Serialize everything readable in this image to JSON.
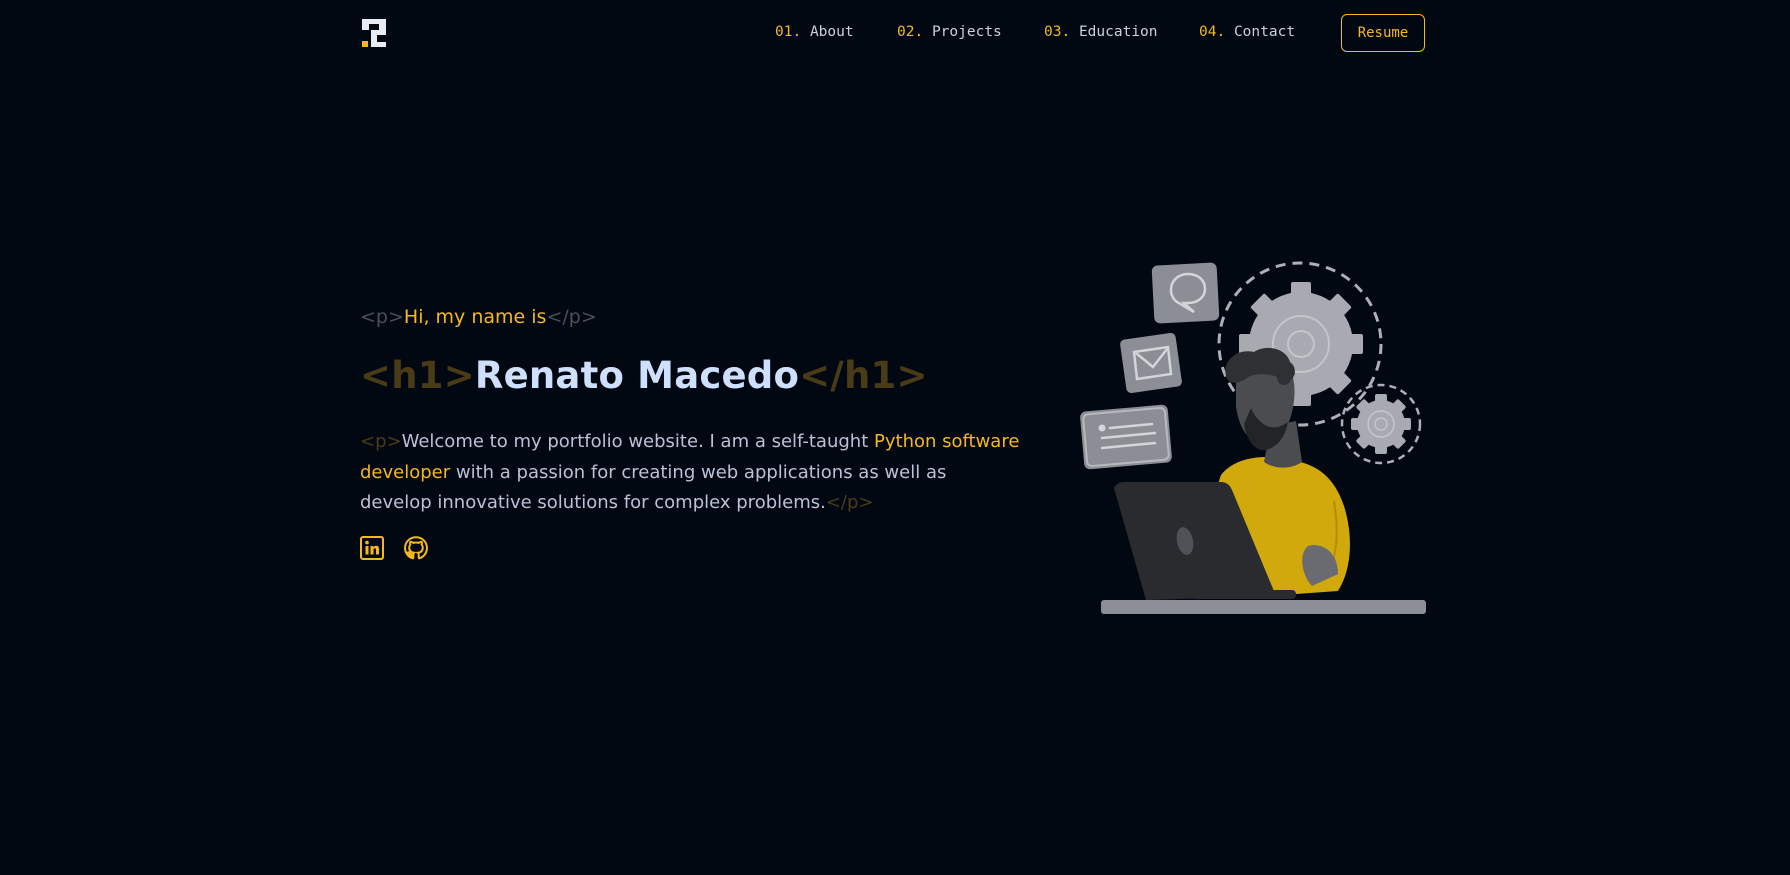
{
  "header": {
    "logo_icon": "monogram-logo-icon",
    "nav": [
      {
        "num": "01.",
        "label": "About"
      },
      {
        "num": "02.",
        "label": "Projects"
      },
      {
        "num": "03.",
        "label": "Education"
      },
      {
        "num": "04.",
        "label": "Contact"
      }
    ],
    "resume_label": "Resume"
  },
  "hero": {
    "intro_open_tag": "<p>",
    "intro_text": "Hi, my name is",
    "intro_close_tag": "</p>",
    "name_open_tag": "<h1>",
    "name": "Renato Macedo",
    "name_close_tag": "</h1>",
    "bio_open_tag": "<p>",
    "bio_part1": "Welcome to my portfolio website. I am a self-taught ",
    "bio_highlight": "Python software developer",
    "bio_part2": " with a passion for creating web applications as well as develop innovative solutions for complex problems.",
    "bio_close_tag": "</p>",
    "socials": [
      {
        "icon": "linkedin-icon"
      },
      {
        "icon": "github-icon"
      }
    ],
    "illustration": "developer-with-laptop-and-gears-illustration"
  },
  "colors": {
    "background": "#020812",
    "accent": "#f5b81f",
    "name": "#cfe0ff",
    "body_text": "#b8c3d6",
    "tag_gray": "#4a4f58"
  }
}
